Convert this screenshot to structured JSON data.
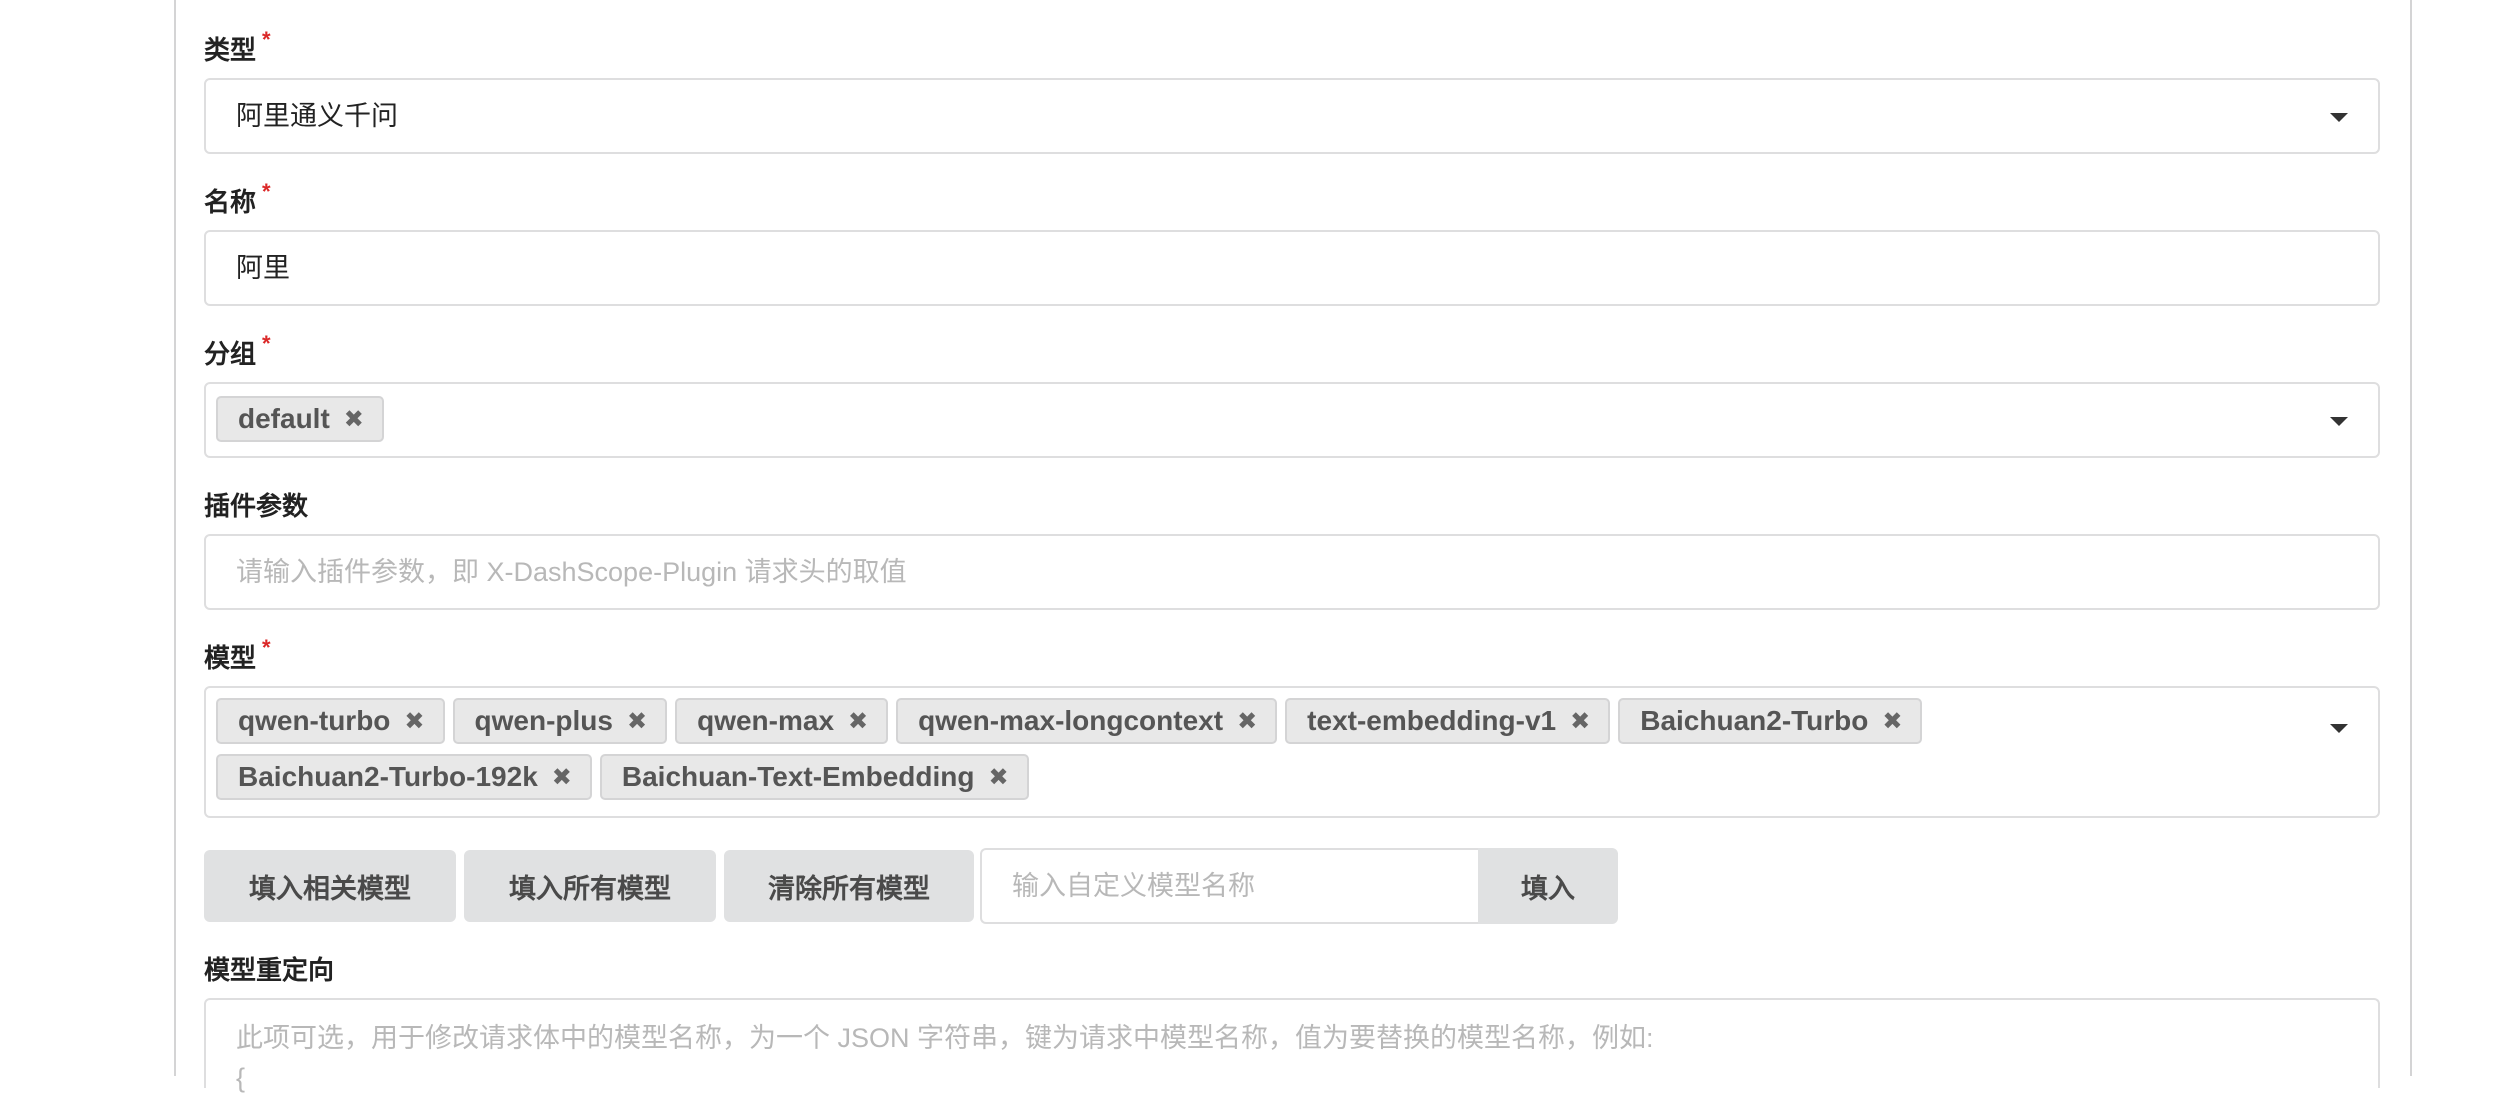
{
  "form": {
    "type": {
      "label": "类型",
      "required_mark": "*",
      "value": "阿里通义千问"
    },
    "name": {
      "label": "名称",
      "required_mark": "*",
      "value": "阿里"
    },
    "group": {
      "label": "分组",
      "required_mark": "*",
      "chips": [
        "default"
      ]
    },
    "plugin": {
      "label": "插件参数",
      "placeholder": "请输入插件参数，即 X-DashScope-Plugin 请求头的取值"
    },
    "models": {
      "label": "模型",
      "required_mark": "*",
      "chips": [
        "qwen-turbo",
        "qwen-plus",
        "qwen-max",
        "qwen-max-longcontext",
        "text-embedding-v1",
        "Baichuan2-Turbo",
        "Baichuan2-Turbo-192k",
        "Baichuan-Text-Embedding"
      ]
    },
    "model_buttons": {
      "fill_related": "填入相关模型",
      "fill_all": "填入所有模型",
      "clear_all": "清除所有模型",
      "custom_placeholder": "输入自定义模型名称",
      "fill": "填入"
    },
    "model_mapping": {
      "label": "模型重定向",
      "placeholder_line1": "此项可选，用于修改请求体中的模型名称，为一个 JSON 字符串，键为请求中模型名称，值为要替换的模型名称，例如:",
      "placeholder_line2": "{"
    }
  },
  "icons": {
    "remove": "x-icon",
    "dropdown": "chevron-down-icon"
  }
}
